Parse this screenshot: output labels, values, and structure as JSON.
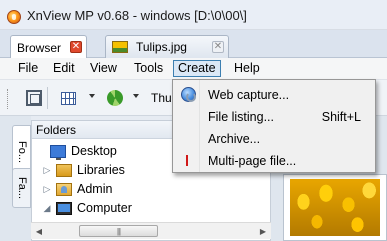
{
  "window": {
    "title": "XnView MP v0.68 - windows [D:\\0\\00\\]"
  },
  "tabs": [
    {
      "label": "Browser",
      "active": true
    },
    {
      "label": "Tulips.jpg",
      "active": false
    }
  ],
  "menubar": {
    "items": [
      "File",
      "Edit",
      "View",
      "Tools",
      "Create",
      "Help"
    ],
    "open_item": "Create"
  },
  "toolbar": {
    "truncated_label": "Thu"
  },
  "create_menu": {
    "items": [
      {
        "label": "Web capture...",
        "shortcut": "",
        "icon": "globe-icon"
      },
      {
        "label": "File listing...",
        "shortcut": "Shift+L",
        "icon": ""
      },
      {
        "label": "Archive...",
        "shortcut": "",
        "icon": ""
      },
      {
        "label": "Multi-page file...",
        "shortcut": "",
        "icon": "multipage-icon"
      }
    ]
  },
  "side_tabs": {
    "folders": "Fo...",
    "favorites": "Fa..."
  },
  "folders_panel": {
    "header": "Folders",
    "tree": [
      {
        "label": "Desktop",
        "icon": "desktop-icon",
        "expander": ""
      },
      {
        "label": "Libraries",
        "icon": "libraries-icon",
        "expander": "▷"
      },
      {
        "label": "Admin",
        "icon": "admin-icon",
        "expander": "▷"
      },
      {
        "label": "Computer",
        "icon": "computer-icon",
        "expander": "◢"
      }
    ]
  },
  "scrollbar": {
    "left_arrow": "◀",
    "right_arrow": "▶",
    "grip": "|||"
  },
  "colors": {
    "menu_highlight": "#dbe8f6",
    "menu_highlight_border": "#3c7fb1",
    "tab_close_active": "#e0492d"
  }
}
